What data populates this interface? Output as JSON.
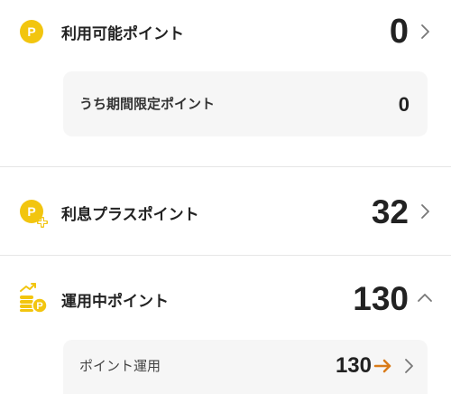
{
  "available": {
    "icon": "p-coin-icon",
    "icon_letter": "P",
    "label": "利用可能ポイント",
    "value": "0",
    "sub": {
      "label": "うち期間限定ポイント",
      "value": "0"
    }
  },
  "interest_plus": {
    "icon": "p-coin-plus-icon",
    "icon_letter": "P",
    "label": "利息プラスポイント",
    "value": "32"
  },
  "investing": {
    "icon": "coin-stack-growth-icon",
    "label": "運用中ポイント",
    "value": "130",
    "expanded": true,
    "sub": {
      "label": "ポイント運用",
      "value": "130"
    }
  },
  "colors": {
    "coin": "#f2c50f",
    "arrow": "#d97b19",
    "card_bg": "#f6f6f6",
    "divider": "#e6e6e6"
  }
}
